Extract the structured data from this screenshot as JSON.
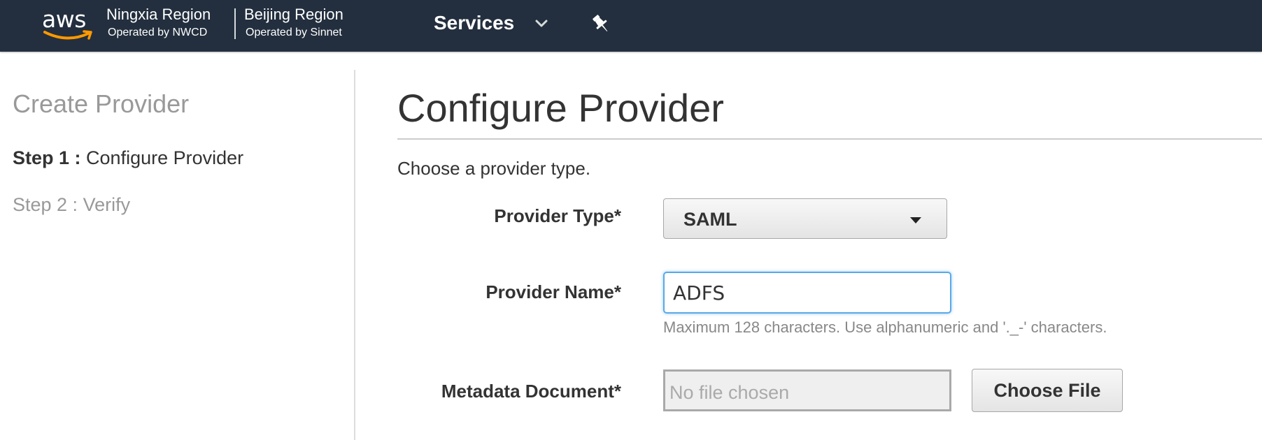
{
  "header": {
    "logo_text": "aws",
    "regions": [
      {
        "name": "Ningxia Region",
        "operator": "Operated by NWCD"
      },
      {
        "name": "Beijing Region",
        "operator": "Operated by Sinnet"
      }
    ],
    "services_label": "Services",
    "icons": [
      "chevron-down-icon",
      "pin-icon"
    ],
    "colors": {
      "bar": "#232f3e",
      "logo_smile": "#ff9900"
    }
  },
  "sidebar": {
    "title": "Create Provider",
    "steps": [
      {
        "number": "Step 1 :",
        "label": "Configure Provider",
        "active": true
      },
      {
        "text": "Step 2 : Verify",
        "active": false
      }
    ]
  },
  "main": {
    "title": "Configure Provider",
    "intro": "Choose a provider type.",
    "fields": {
      "provider_type": {
        "label": "Provider Type*",
        "value": "SAML"
      },
      "provider_name": {
        "label": "Provider Name*",
        "value": "ADFS",
        "hint": "Maximum 128 characters. Use alphanumeric and '._-' characters."
      },
      "metadata": {
        "label": "Metadata Document*",
        "placeholder": "No file chosen",
        "button": "Choose File"
      }
    }
  }
}
